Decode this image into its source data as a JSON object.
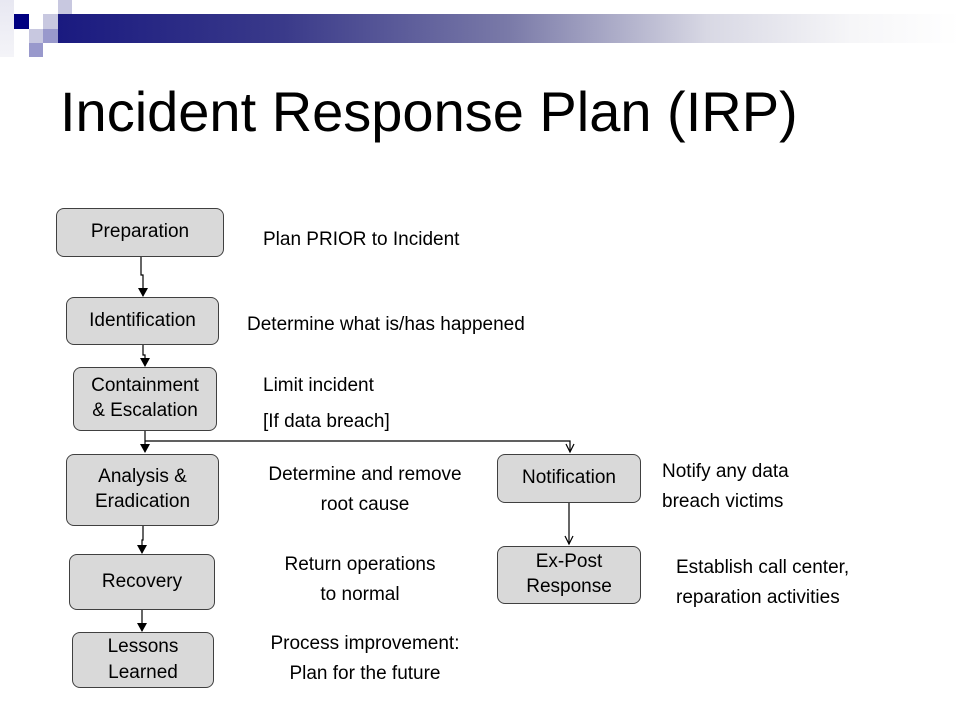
{
  "slide": {
    "title": "Incident Response Plan (IRP)",
    "accent_color": "#1a1a80"
  },
  "flow": {
    "steps": [
      {
        "label_lines": [
          "Preparation"
        ],
        "description": [
          "Plan PRIOR to Incident"
        ]
      },
      {
        "label_lines": [
          "Identification"
        ],
        "description": [
          "Determine what is/has happened"
        ]
      },
      {
        "label_lines": [
          "Containment",
          "& Escalation"
        ],
        "description": [
          "Limit incident"
        ]
      },
      {
        "label_lines": [
          "Analysis &",
          "Eradication"
        ],
        "description": [
          "Determine and remove",
          "root cause"
        ]
      },
      {
        "label_lines": [
          "Recovery"
        ],
        "description": [
          "Return operations",
          "to normal"
        ]
      },
      {
        "label_lines": [
          "Lessons",
          "Learned"
        ],
        "description": [
          "Process improvement:",
          "Plan for the future"
        ]
      }
    ],
    "branch_condition": "[If data breach]",
    "breach_steps": [
      {
        "label_lines": [
          "Notification"
        ],
        "description": [
          "Notify any data",
          "breach victims"
        ]
      },
      {
        "label_lines": [
          "Ex-Post",
          "Response"
        ],
        "description": [
          "Establish call center,",
          "reparation activities"
        ]
      }
    ]
  }
}
